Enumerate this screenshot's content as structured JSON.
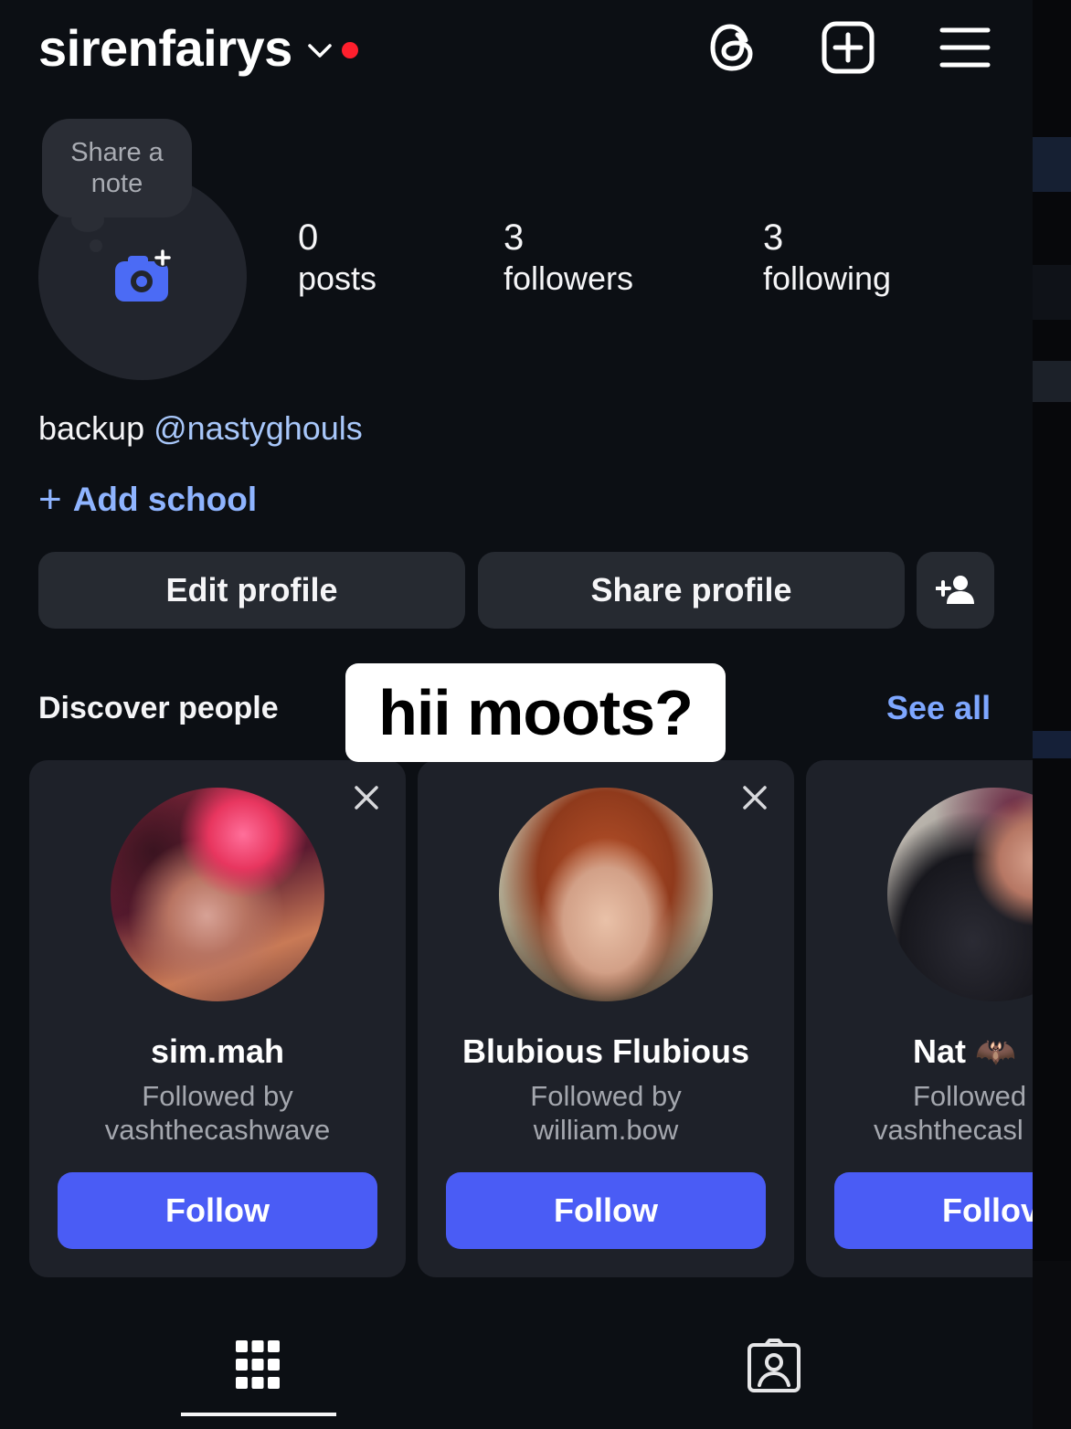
{
  "header": {
    "username": "sirenfairys",
    "icons": [
      "chevron-down-icon",
      "threads-icon",
      "new-post-icon",
      "menu-icon"
    ],
    "notification_dot_color": "#ff1f2d"
  },
  "profile": {
    "note_bubble": "Share a note",
    "avatar_icon": "camera-add-icon",
    "stats": [
      {
        "value": "0",
        "label": "posts"
      },
      {
        "value": "3",
        "label": "followers"
      },
      {
        "value": "3",
        "label": "following"
      }
    ],
    "bio_text": "backup",
    "bio_mention": "@nastyghouls",
    "add_school": "Add school"
  },
  "actions": {
    "edit_profile": "Edit profile",
    "share_profile": "Share profile",
    "discover_icon": "add-person-icon"
  },
  "discover": {
    "title": "Discover people",
    "see_all": "See all",
    "sticker_text": "hii moots?",
    "cards": [
      {
        "name": "sim.mah",
        "followed_by_label": "Followed by",
        "followed_by": "vashthecashwave",
        "button": "Follow"
      },
      {
        "name": "Blubious Flubious",
        "followed_by_label": "Followed by",
        "followed_by": "william.bow",
        "button": "Follow"
      },
      {
        "name": "Nat 🦇",
        "followed_by_label": "Followed",
        "followed_by": "vashthecasl",
        "button": "Follov"
      }
    ]
  },
  "tabs": {
    "icons": [
      "grid-icon",
      "tagged-icon"
    ],
    "active": "grid-icon"
  },
  "colors": {
    "background": "#0c0f14",
    "accent": "#4a5cf5",
    "link": "#a8c7fa",
    "add_school": "#8fb4ff",
    "see_all": "#7ea7ff",
    "camera": "#4b6bf5",
    "button_bg": "#262a31"
  }
}
